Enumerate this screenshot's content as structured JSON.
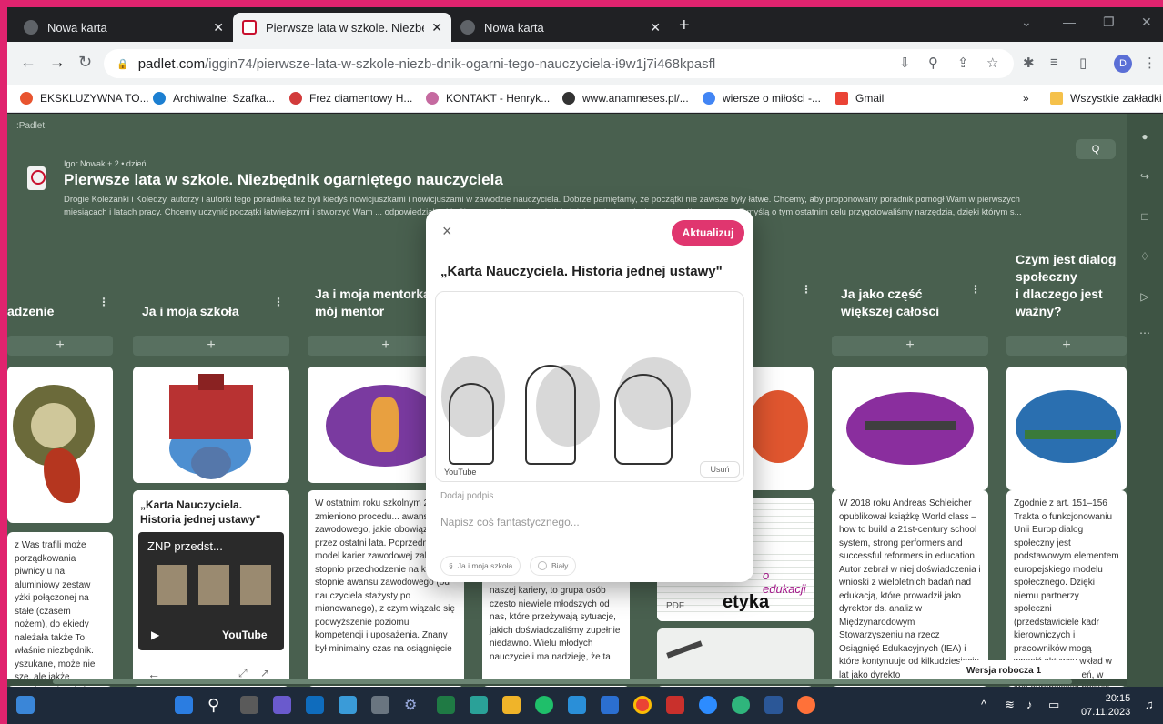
{
  "browser": {
    "tabs": [
      {
        "title": "Nowa karta",
        "active": false
      },
      {
        "title": "Pierwsze lata w szkole. Niezbędn",
        "active": true
      },
      {
        "title": "Nowa karta",
        "active": false
      }
    ],
    "url_host": "padlet.com",
    "url_path": "/iggin74/pierwsze-lata-w-szkole-niezb-dnik-ogarni-tego-nauczyciela-i9w1j7i468kpasfl",
    "profile_initial": "D",
    "bookmarks": [
      {
        "label": "EKSKLUZYWNA TO...",
        "color": "#e8542f"
      },
      {
        "label": "Archiwalne: Szafka...",
        "color": "#1c7fd1"
      },
      {
        "label": "Frez diamentowy H...",
        "color": "#d23b3b"
      },
      {
        "label": "KONTAKT - Henryk...",
        "color": "#c56aa0"
      },
      {
        "label": "www.anamneses.pl/...",
        "color": "#333333"
      },
      {
        "label": "wiersze o miłości -...",
        "color": "#4285f4"
      },
      {
        "label": "Gmail",
        "color": "#ea4335"
      }
    ],
    "bookmarks_more": "»",
    "all_bookmarks": "Wszystkie zakładki"
  },
  "padlet": {
    "brand": ":Padlet",
    "author": "Igor Nowak + 2 • dzień",
    "title": "Pierwsze lata w szkole. Niezbędnik ogarniętego nauczyciela",
    "description": "Drogie Koleżanki i Koledzy, autorzy i autorki tego poradnika też byli kiedyś nowicjuszkami i nowicjuszami w zawodzie nauczyciela. Dobrze pamiętamy, że początki nie zawsze były łatwe. Chcemy, aby proponowany poradnik pomógł Wam w pierwszych miesiącach i latach pracy. Chcemy uczynić początki łatwiejszymi i stworzyć Wam ... odpowiedzialność. Chcemy także podpowiedzieć, jak zaplanować własny rozwój zawodowy. Z myślą o tym ostatnim celu przygotowaliśmy narzędzia, dzięki którym s...",
    "search_icon": "Q",
    "columns": [
      {
        "title": "adzenie",
        "menu": "⋮"
      },
      {
        "title": "Ja i moja szkoła",
        "menu": "⋮"
      },
      {
        "title": "Ja i moja mentorka\nmój mentor",
        "menu": "⋮"
      },
      {
        "title": "",
        "menu": "⋮"
      },
      {
        "title": "Ja jako część\nwiększej całości",
        "menu": "⋮"
      },
      {
        "title": "Czym jest dialog\nspołeczny\ni dlaczego jest\nważny?",
        "menu": ""
      }
    ],
    "add": "+",
    "cards": {
      "col0_text": "z Was trafili może porządkowania piwnicy u na aluminiowy zestaw yżki połączonej na stałe (czasem nożem), do ekiedy należała także To właśnie niezbędnik. yszukane, może nie sze, ale jakże przydatne bez którego nie sposób",
      "col1_title": "„Karta Nauczyciela. Historia jednej ustawy\"",
      "col1_video_title": "ZNP przedst...",
      "col1_video_brand": "YouTube",
      "col2_text": "W ostatnim roku szkolnym 2022/23 zmieniono procedu... awansu zawodowego, jakie obowiązywały przez ostatni lata. Poprzedni model karier zawodowej zakładał stopnio przechodzenie na kolejne stopnie awansu zawodowego (od nauczyciela stażysty po mianowanego), z czym wiązało się podwyższenie poziomu kompetencji i uposażenia. Znany był minimalny czas na osiągnięcie",
      "col3_text": "naszej kariery, to grupa osób często niewiele młodszych od nas, które przeżywają sytuacje, jakich doświadczaliśmy zupełnie niedawno. Wielu młodych nauczycieli ma nadzieję, że ta",
      "col3_pdf": "PDF",
      "col3_etyka": "etyka",
      "col3_edukacja": "o edukacji",
      "col4_text": "W 2018 roku Andreas Schleicher opublikował książkę World class – how to build a 21st-century school system, strong performers and successful reformers in education. Autor zebrał w niej doświadczenia i wnioski z wieloletnich badań nad edukacją, które prowadził jako dyrektor ds. analiz w Międzynarodowym Stowarzyszeniu na rzecz Osiągnięć Edukacyjnych (IEA) i które kontynuuje od kilkudziesięciu lat jako dyrekto",
      "col5_text": "Zgodnie z art. 151–156 Trakta o funkcjonowaniu Unii Europ dialog społeczny jest podstawowym elementem europejskiego modelu społecznego. Dzięki niemu partnerzy społeczni (przedstawiciele kadr kierowniczych i pracowników mogą wnosić aktywny wkład w drodze porozumień, w two europejskiej polityki społeczn"
    },
    "modal": {
      "close": "×",
      "update_button": "Aktualizuj",
      "title": "„Karta Nauczyciela. Historia jednej ustawy\"",
      "media_source": "YouTube",
      "remove": "Usuń",
      "caption": "Dodaj podpis",
      "placeholder": "Napisz coś fantastycznego...",
      "chip_column": "Ja i moja szkoła",
      "chip_color": "Biały"
    },
    "draft": "Wersja robocza 1"
  },
  "taskbar": {
    "time": "20:15",
    "date": "07.11.2023"
  },
  "colors": {
    "board_bg": "#49604f",
    "accent": "#e0366f",
    "frame": "#e0236e"
  }
}
